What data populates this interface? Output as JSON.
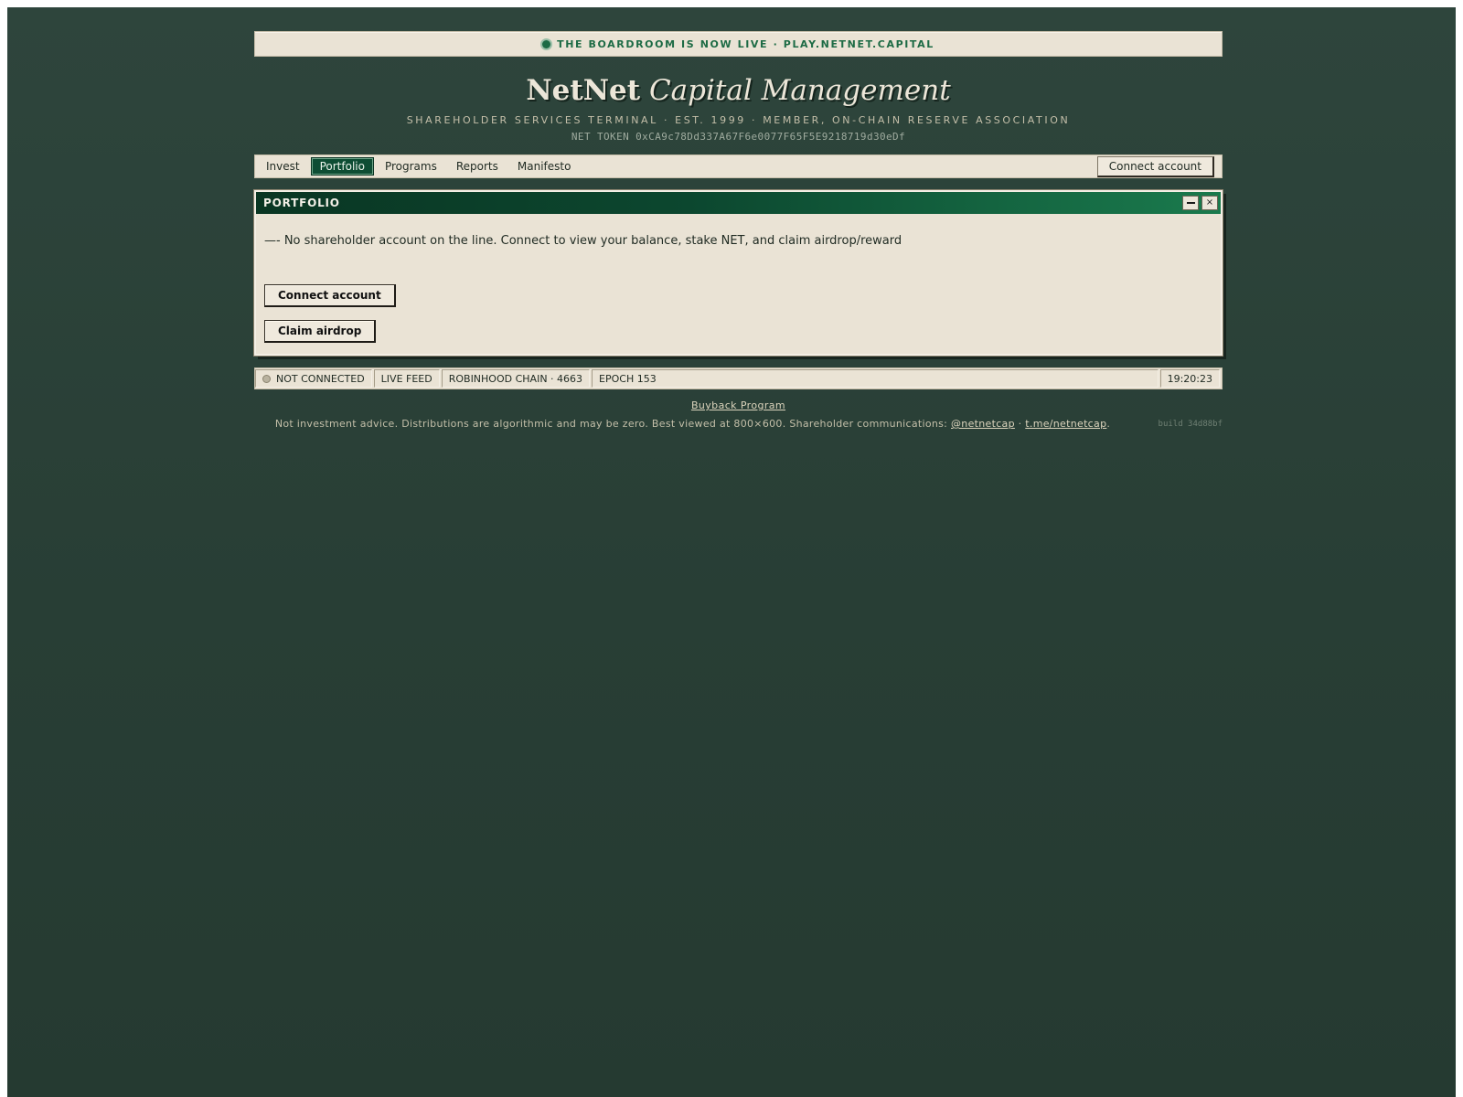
{
  "announcement": {
    "text": "THE BOARDROOM IS NOW LIVE · PLAY.NETNET.CAPITAL"
  },
  "masthead": {
    "title_bold": "NetNet",
    "title_italic": "Capital Management",
    "subtitle": "SHAREHOLDER SERVICES TERMINAL · EST. 1999 · MEMBER, ON-CHAIN RESERVE ASSOCIATION",
    "token": "NET TOKEN 0xCA9c78Dd337A67F6e0077F65F5E9218719d30eDf"
  },
  "nav": {
    "items": [
      {
        "label": "Invest",
        "active": false
      },
      {
        "label": "Portfolio",
        "active": true
      },
      {
        "label": "Programs",
        "active": false
      },
      {
        "label": "Reports",
        "active": false
      },
      {
        "label": "Manifesto",
        "active": false
      }
    ],
    "connect_label": "Connect account"
  },
  "window": {
    "title": "PORTFOLIO",
    "minimize_icon": "minimize-icon",
    "close_icon": "close-icon",
    "close_glyph": "×",
    "message": "—- No shareholder account on the line. Connect to view your balance, stake NET, and claim airdrop/reward",
    "connect_button": "Connect account",
    "claim_button": "Claim airdrop"
  },
  "statusbar": {
    "connection": "NOT CONNECTED",
    "feed": "LIVE FEED",
    "chain": "ROBINHOOD CHAIN · 4663",
    "epoch": "EPOCH 153",
    "clock": "19:20:23"
  },
  "footer": {
    "buyback_link": "Buyback Program",
    "disclaimer_text": "Not investment advice. Distributions are algorithmic and may be zero. Best viewed at 800×600. Shareholder communications: ",
    "handle_link": "@netnetcap",
    "separator": " · ",
    "telegram_link": "t.me/netnetcap",
    "end": ".",
    "build": "build 34d88bf"
  },
  "colors": {
    "background": "#2b4239",
    "panel": "#eae3d5",
    "accent_green": "#0e4d34",
    "announce_green": "#1d6b45"
  }
}
